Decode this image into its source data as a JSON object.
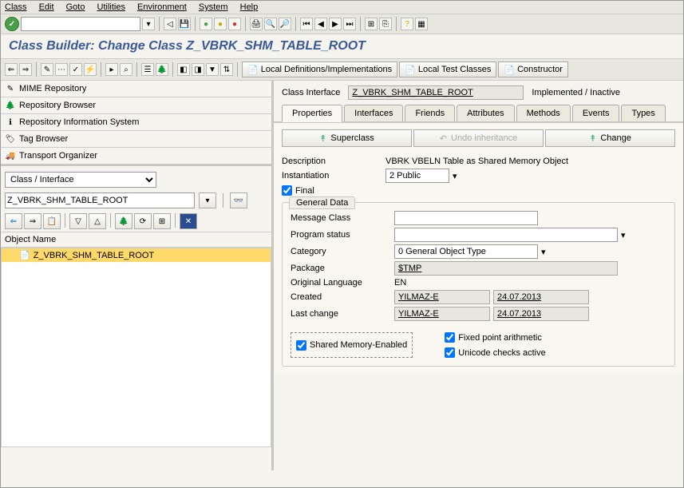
{
  "menu": {
    "class": "Class",
    "edit": "Edit",
    "goto": "Goto",
    "utilities": "Utilities",
    "environment": "Environment",
    "system": "System",
    "help": "Help"
  },
  "title": "Class Builder: Change Class Z_VBRK_SHM_TABLE_ROOT",
  "toolbar2": {
    "localdef": "Local Definitions/Implementations",
    "localtest": "Local Test Classes",
    "constructor": "Constructor"
  },
  "nav": {
    "mime": "MIME Repository",
    "repo": "Repository Browser",
    "ris": "Repository Information System",
    "tag": "Tag Browser",
    "transport": "Transport Organizer"
  },
  "selector": {
    "type": "Class / Interface",
    "name": "Z_VBRK_SHM_TABLE_ROOT"
  },
  "tree": {
    "header": "Object Name",
    "item": "Z_VBRK_SHM_TABLE_ROOT"
  },
  "classinterface": {
    "label": "Class Interface",
    "value": "Z_VBRK_SHM_TABLE_ROOT",
    "status": "Implemented / Inactive"
  },
  "tabs": {
    "properties": "Properties",
    "interfaces": "Interfaces",
    "friends": "Friends",
    "attributes": "Attributes",
    "methods": "Methods",
    "events": "Events",
    "types": "Types"
  },
  "actions": {
    "superclass": "Superclass",
    "undo": "Undo inheritance",
    "change": "Change"
  },
  "form": {
    "description_label": "Description",
    "description": "VBRK VBELN Table as Shared Memory Object",
    "instantiation_label": "Instantiation",
    "instantiation": "2 Public",
    "final_label": "Final"
  },
  "general": {
    "title": "General Data",
    "msgclass_label": "Message Class",
    "msgclass": "",
    "progstatus_label": "Program status",
    "progstatus": "",
    "category_label": "Category",
    "category": "0 General Object Type",
    "package_label": "Package",
    "package": "$TMP",
    "origlang_label": "Original Language",
    "origlang": "EN",
    "created_label": "Created",
    "created_by": "YILMAZ-E",
    "created_on": "24.07.2013",
    "changed_label": "Last change",
    "changed_by": "YILMAZ-E",
    "changed_on": "24.07.2013",
    "shm_label": "Shared Memory-Enabled",
    "fixed_label": "Fixed point arithmetic",
    "unicode_label": "Unicode checks active"
  }
}
